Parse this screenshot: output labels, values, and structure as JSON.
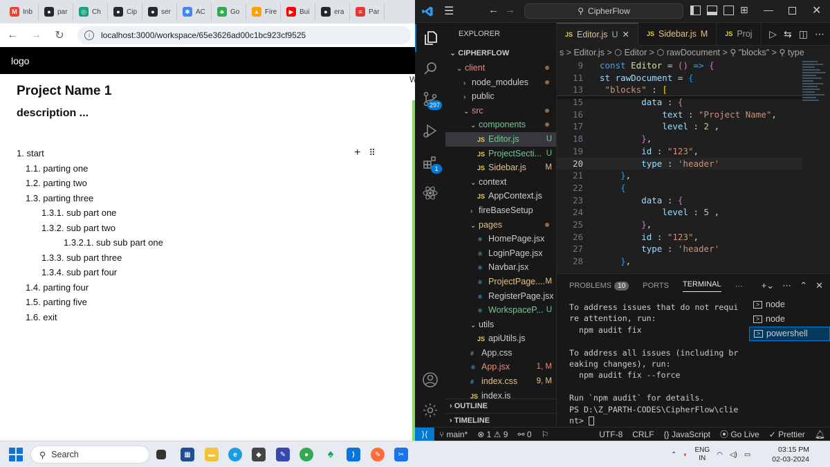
{
  "browser": {
    "tabs": [
      {
        "label": "Inb",
        "icon": "gmail-icon",
        "color": "#ea4335",
        "glyph": "M"
      },
      {
        "label": "par",
        "icon": "github-icon",
        "color": "#24292f",
        "glyph": "●"
      },
      {
        "label": "Ch",
        "icon": "chatgpt-icon",
        "color": "#10a37f",
        "glyph": "◎"
      },
      {
        "label": "Cip",
        "icon": "github-icon",
        "color": "#24292f",
        "glyph": "●"
      },
      {
        "label": "ser",
        "icon": "github-icon",
        "color": "#24292f",
        "glyph": "●"
      },
      {
        "label": "AC",
        "icon": "pinwheel-icon",
        "color": "#4285f4",
        "glyph": "✱"
      },
      {
        "label": "Go",
        "icon": "tree-icon",
        "color": "#34a853",
        "glyph": "♣"
      },
      {
        "label": "Fire",
        "icon": "firebase-icon",
        "color": "#ffa000",
        "glyph": "▲"
      },
      {
        "label": "Bui",
        "icon": "youtube-icon",
        "color": "#ff0000",
        "glyph": "▶"
      },
      {
        "label": "era",
        "icon": "github-icon",
        "color": "#24292f",
        "glyph": "●"
      },
      {
        "label": "Par",
        "icon": "stripes-icon",
        "color": "#e53935",
        "glyph": "≡"
      }
    ],
    "url": "localhost:3000/workspace/65e3626ad00c1bc923cf9525"
  },
  "app": {
    "logo": "logo",
    "project_title": "Project Name 1",
    "description": "description ...",
    "outline": [
      {
        "text": "1. start",
        "level": 1
      },
      {
        "text": "1.1. parting one",
        "level": 2
      },
      {
        "text": "1.2. parting two",
        "level": 2
      },
      {
        "text": "1.3. parting three",
        "level": 2
      },
      {
        "text": "1.3.1. sub part one",
        "level": 3
      },
      {
        "text": "1.3.2. sub part two",
        "level": 3
      },
      {
        "text": "1.3.2.1. sub sub part one",
        "level": 4
      },
      {
        "text": "1.3.3. sub part three",
        "level": 3
      },
      {
        "text": "1.3.4. sub part four",
        "level": 3
      },
      {
        "text": "1.4. parting four",
        "level": 2
      },
      {
        "text": "1.5. parting five",
        "level": 2
      },
      {
        "text": "1.6. exit",
        "level": 2
      }
    ],
    "add_glyph": "+",
    "drag_glyph": "⠿",
    "edge_char": "W"
  },
  "vscode": {
    "command_center": "CipherFlow",
    "scm_badge": "297",
    "ext_badge": "1",
    "explorer_title": "EXPLORER",
    "root_folder": "CIPHERFLOW",
    "tree": [
      {
        "label": "client",
        "depth": 1,
        "type": "folder",
        "open": true,
        "color": "c-red",
        "dot": true
      },
      {
        "label": "node_modules",
        "depth": 2,
        "type": "folder",
        "open": false,
        "color": "",
        "dot": true
      },
      {
        "label": "public",
        "depth": 2,
        "type": "folder",
        "open": false,
        "color": "",
        "dot": false
      },
      {
        "label": "src",
        "depth": 2,
        "type": "folder",
        "open": true,
        "color": "c-red",
        "dot": true
      },
      {
        "label": "components",
        "depth": 3,
        "type": "folder",
        "open": true,
        "color": "c-green",
        "dot": true
      },
      {
        "label": "Editor.js",
        "depth": 4,
        "type": "js",
        "color": "c-green",
        "status": "U",
        "sel": true
      },
      {
        "label": "ProjectSecti...",
        "depth": 4,
        "type": "js",
        "color": "c-green",
        "status": "U"
      },
      {
        "label": "Sidebar.js",
        "depth": 4,
        "type": "js",
        "color": "c-orange",
        "status": "M"
      },
      {
        "label": "context",
        "depth": 3,
        "type": "folder",
        "open": true,
        "color": "",
        "dot": false
      },
      {
        "label": "AppContext.js",
        "depth": 4,
        "type": "js",
        "color": "",
        "status": ""
      },
      {
        "label": "fireBaseSetup",
        "depth": 3,
        "type": "folder",
        "open": false,
        "color": "",
        "dot": false
      },
      {
        "label": "pages",
        "depth": 3,
        "type": "folder",
        "open": true,
        "color": "c-orange",
        "dot": true
      },
      {
        "label": "HomePage.jsx",
        "depth": 4,
        "type": "react",
        "color": "",
        "status": ""
      },
      {
        "label": "LoginPage.jsx",
        "depth": 4,
        "type": "react",
        "color": "",
        "status": ""
      },
      {
        "label": "Navbar.jsx",
        "depth": 4,
        "type": "react",
        "color": "",
        "status": ""
      },
      {
        "label": "ProjectPage....",
        "depth": 4,
        "type": "react",
        "color": "c-orange",
        "status": "M"
      },
      {
        "label": "RegisterPage.jsx",
        "depth": 4,
        "type": "react",
        "color": "",
        "status": ""
      },
      {
        "label": "WorkspaceP...",
        "depth": 4,
        "type": "react",
        "color": "c-green",
        "status": "U"
      },
      {
        "label": "utils",
        "depth": 3,
        "type": "folder",
        "open": true,
        "color": "",
        "dot": false
      },
      {
        "label": "apiUtils.js",
        "depth": 4,
        "type": "js",
        "color": "",
        "status": ""
      },
      {
        "label": "App.css",
        "depth": 3,
        "type": "css",
        "color": "",
        "status": ""
      },
      {
        "label": "App.jsx",
        "depth": 3,
        "type": "react",
        "color": "c-red",
        "status": "1, M"
      },
      {
        "label": "index.css",
        "depth": 3,
        "type": "css",
        "color": "c-orange",
        "status": "9, M"
      },
      {
        "label": "index.js",
        "depth": 3,
        "type": "js",
        "color": "",
        "status": ""
      }
    ],
    "outline_label": "OUTLINE",
    "timeline_label": "TIMELINE",
    "tabs": [
      {
        "label": "Editor.js",
        "status": "U",
        "active": true
      },
      {
        "label": "Sidebar.js",
        "status": "M",
        "active": false
      },
      {
        "label": "Proj",
        "status": "",
        "active": false
      }
    ],
    "breadcrumbs": "s > Editor.js > ⬡ Editor > ⬡ rawDocument > ⚲ \"blocks\" > ⚲ type",
    "sticky_lines": [
      {
        "n": "9",
        "html": "<span class='kw'>const</span> <span class='fn'>Editor</span> <span class='pn'>=</span> <span class='br2'>()</span> <span class='kw'>=&gt;</span> <span class='br2'>{</span>"
      },
      {
        "n": "11",
        "html": "<span class='vr'>st rawDocument</span> <span class='pn'>=</span> <span class='br3'>{</span>"
      },
      {
        "n": "13",
        "html": "<span class='str'> \"blocks\"</span> <span class='pn'>:</span> <span class='br1'>[</span>"
      }
    ],
    "code_lines": [
      {
        "n": "15",
        "html": "        <span class='vr'>data</span> <span class='pn'>:</span> <span class='br2'>{</span>"
      },
      {
        "n": "16",
        "html": "            <span class='vr'>text</span> <span class='pn'>:</span> <span class='str'>\"Project Name\"</span><span class='pn'>,</span>"
      },
      {
        "n": "17",
        "html": "            <span class='vr'>level</span> <span class='pn'>:</span> <span class='num'>2</span> <span class='pn'>,</span>"
      },
      {
        "n": "18",
        "html": "        <span class='br2'>}</span><span class='pn'>,</span>"
      },
      {
        "n": "19",
        "html": "        <span class='vr'>id</span> <span class='pn'>:</span> <span class='str'>\"123\"</span><span class='pn'>,</span>"
      },
      {
        "n": "20",
        "html": "        <span class='vr'>type</span> <span class='pn'>:</span> <span class='str'>'header'</span>",
        "cur": true
      },
      {
        "n": "21",
        "html": "    <span class='br3'>}</span><span class='pn'>,</span>"
      },
      {
        "n": "22",
        "html": "    <span class='br3'>{</span>"
      },
      {
        "n": "23",
        "html": "        <span class='vr'>data</span> <span class='pn'>:</span> <span class='br2'>{</span>"
      },
      {
        "n": "24",
        "html": "            <span class='vr'>level</span> <span class='pn'>:</span> <span class='num'>5</span> <span class='pn'>,</span>"
      },
      {
        "n": "25",
        "html": "        <span class='br2'>}</span><span class='pn'>,</span>"
      },
      {
        "n": "26",
        "html": "        <span class='vr'>id</span> <span class='pn'>:</span> <span class='str'>\"123\"</span><span class='pn'>,</span>"
      },
      {
        "n": "27",
        "html": "        <span class='vr'>type</span> <span class='pn'>:</span> <span class='str'>'header'</span>"
      },
      {
        "n": "28",
        "html": "    <span class='br3'>}</span><span class='pn'>,</span>"
      }
    ],
    "panel_tabs": {
      "problems": "PROBLEMS",
      "problems_count": "10",
      "ports": "PORTS",
      "terminal": "TERMINAL"
    },
    "terminal_lines": [
      "To address issues that do not requi",
      "re attention, run:",
      "  npm audit fix",
      "",
      "To address all issues (including br",
      "eaking changes), run:",
      "  npm audit fix --force",
      "",
      "Run `npm audit` for details.",
      "PS D:\\Z_PARTH-CODES\\CipherFlow\\clie",
      "nt> "
    ],
    "terminals": [
      {
        "label": "node",
        "sel": false
      },
      {
        "label": "node",
        "sel": false
      },
      {
        "label": "powershell",
        "sel": true
      }
    ],
    "status": {
      "branch": "main*",
      "errors": "1",
      "warnings": "9",
      "ports": "0",
      "encoding": "UTF-8",
      "eol": "CRLF",
      "language": "JavaScript",
      "golive": "Go Live",
      "prettier": "Prettier"
    }
  },
  "taskbar": {
    "search_placeholder": "Search",
    "lang": "ENG",
    "region": "IN",
    "time": "03:15 PM",
    "date": "02-03-2024"
  }
}
